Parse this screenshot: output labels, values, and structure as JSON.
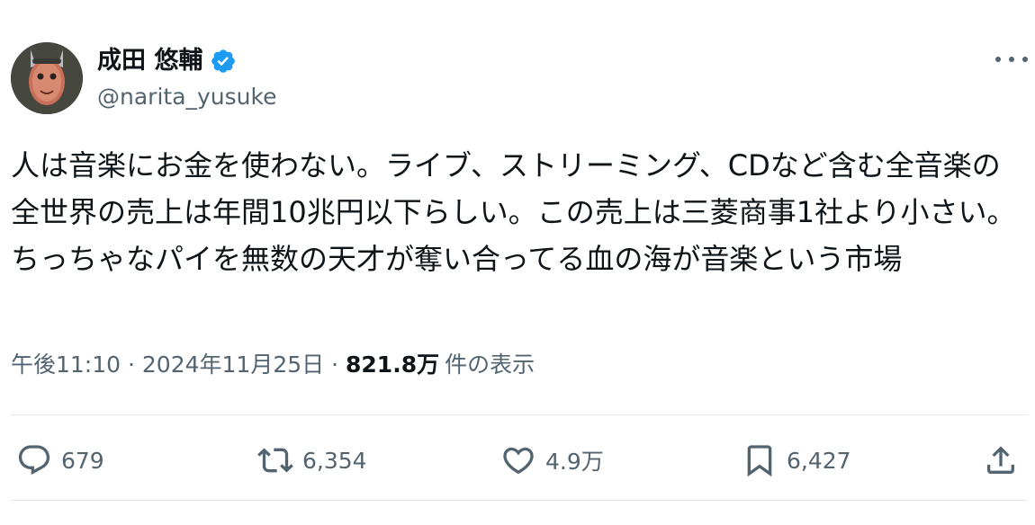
{
  "author": {
    "display_name": "成田 悠輔",
    "handle": "@narita_yusuke",
    "avatar_icon": "avatar-mask-icon",
    "verified_color": "#1d9bf0"
  },
  "tweet": {
    "text": "人は音楽にお金を使わない。ライブ、ストリーミング、CDなど含む全音楽の全世界の売上は年間10兆円以下らしい。この売上は三菱商事1社より小さい。ちっちゃなパイを無数の天才が奪い合ってる血の海が音楽という市場"
  },
  "meta": {
    "time": "午後11:10",
    "sep1": "·",
    "date": "2024年11月25日",
    "sep2": "·",
    "views": "821.8万",
    "views_label": "件の表示"
  },
  "actions": {
    "replies": "679",
    "retweets": "6,354",
    "likes": "4.9万",
    "bookmarks": "6,427",
    "reply_icon": "reply-icon",
    "retweet_icon": "retweet-icon",
    "like_icon": "heart-icon",
    "bookmark_icon": "bookmark-icon",
    "share_icon": "share-icon"
  },
  "colors": {
    "text": "#0f1419",
    "secondary": "#536471",
    "divider": "#e4e7ea"
  }
}
